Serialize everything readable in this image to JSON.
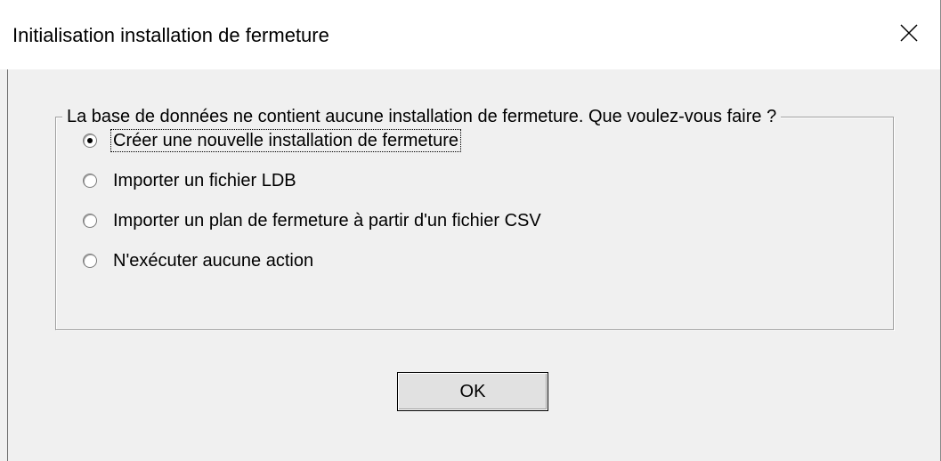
{
  "window": {
    "title": "Initialisation installation de fermeture",
    "close_icon": "close-icon"
  },
  "group": {
    "legend": "La base de données ne contient aucune installation de fermeture. Que voulez-vous faire ?",
    "options": [
      {
        "label": "Créer une nouvelle installation de fermeture",
        "checked": true
      },
      {
        "label": "Importer un fichier LDB",
        "checked": false
      },
      {
        "label": "Importer un plan de fermeture à partir d'un fichier CSV",
        "checked": false
      },
      {
        "label": "N'exécuter aucune action",
        "checked": false
      }
    ]
  },
  "buttons": {
    "ok_label": "OK"
  },
  "colors": {
    "titlebar_bg": "#ffffff",
    "client_bg": "#f0f0f0",
    "button_bg": "#e1e1e1"
  }
}
